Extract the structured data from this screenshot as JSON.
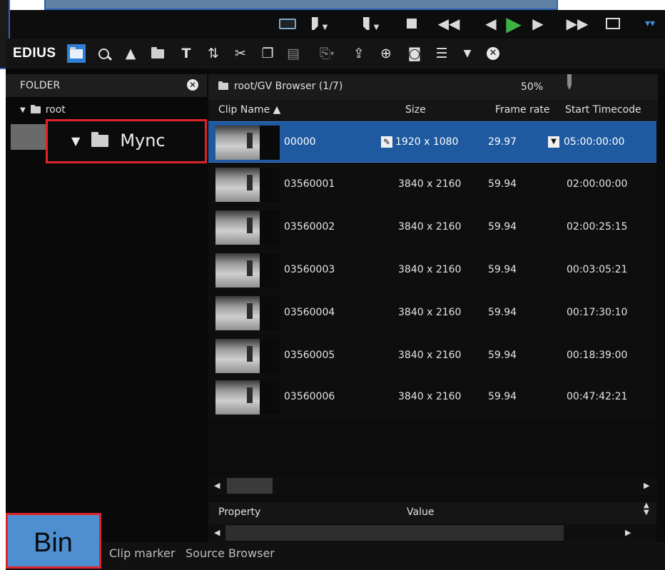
{
  "app": {
    "logo": "EDIUS"
  },
  "transport": {
    "icons": [
      "monitor-icon",
      "mark-in-icon",
      "mark-out-icon",
      "stop-icon",
      "rewind-icon",
      "step-back-icon",
      "play-icon",
      "step-forward-icon",
      "fast-forward-icon",
      "loop-icon",
      "expand-icon"
    ],
    "colors": {
      "play": "#3fb244"
    }
  },
  "toolbar": {
    "icons": [
      "folder-icon",
      "search-icon",
      "up-icon",
      "open-folder-icon",
      "title-icon",
      "refresh-icon",
      "cut-icon",
      "copy-icon",
      "paste-icon",
      "export-icon",
      "send-icon",
      "add-icon",
      "register-icon",
      "list-view-icon",
      "dropdown-icon",
      "close-icon"
    ]
  },
  "folder_panel": {
    "header": "FOLDER",
    "tree": [
      {
        "label": "root",
        "expanded": true
      },
      {
        "label": "Mync",
        "expanded": true,
        "highlighted": true
      }
    ]
  },
  "browser": {
    "path": "root/GV Browser (1/7)",
    "zoom": "50%",
    "columns": [
      "Clip Name ▲",
      "Size",
      "Frame rate",
      "Start Timecode"
    ],
    "rows": [
      {
        "name": "00000",
        "size": "1920 x 1080",
        "frame_rate": "29.97",
        "start_tc": "05:00:00:00",
        "selected": true
      },
      {
        "name": "03560001",
        "size": "3840 x 2160",
        "frame_rate": "59.94",
        "start_tc": "02:00:00:00"
      },
      {
        "name": "03560002",
        "size": "3840 x 2160",
        "frame_rate": "59.94",
        "start_tc": "02:00:25:15"
      },
      {
        "name": "03560003",
        "size": "3840 x 2160",
        "frame_rate": "59.94",
        "start_tc": "00:03:05:21"
      },
      {
        "name": "03560004",
        "size": "3840 x 2160",
        "frame_rate": "59.94",
        "start_tc": "00:17:30:10"
      },
      {
        "name": "03560005",
        "size": "3840 x 2160",
        "frame_rate": "59.94",
        "start_tc": "00:18:39:00"
      },
      {
        "name": "03560006",
        "size": "3840 x 2160",
        "frame_rate": "59.94",
        "start_tc": "00:47:42:21"
      }
    ]
  },
  "property": {
    "col1": "Property",
    "col2": "Value"
  },
  "bottom_tabs": [
    "Bin",
    "Clip marker",
    "Source Browser"
  ],
  "colors": {
    "selected_row": "#1f5aa0",
    "highlight_border": "#e0232b",
    "bin_tab": "#4e8fd2"
  }
}
